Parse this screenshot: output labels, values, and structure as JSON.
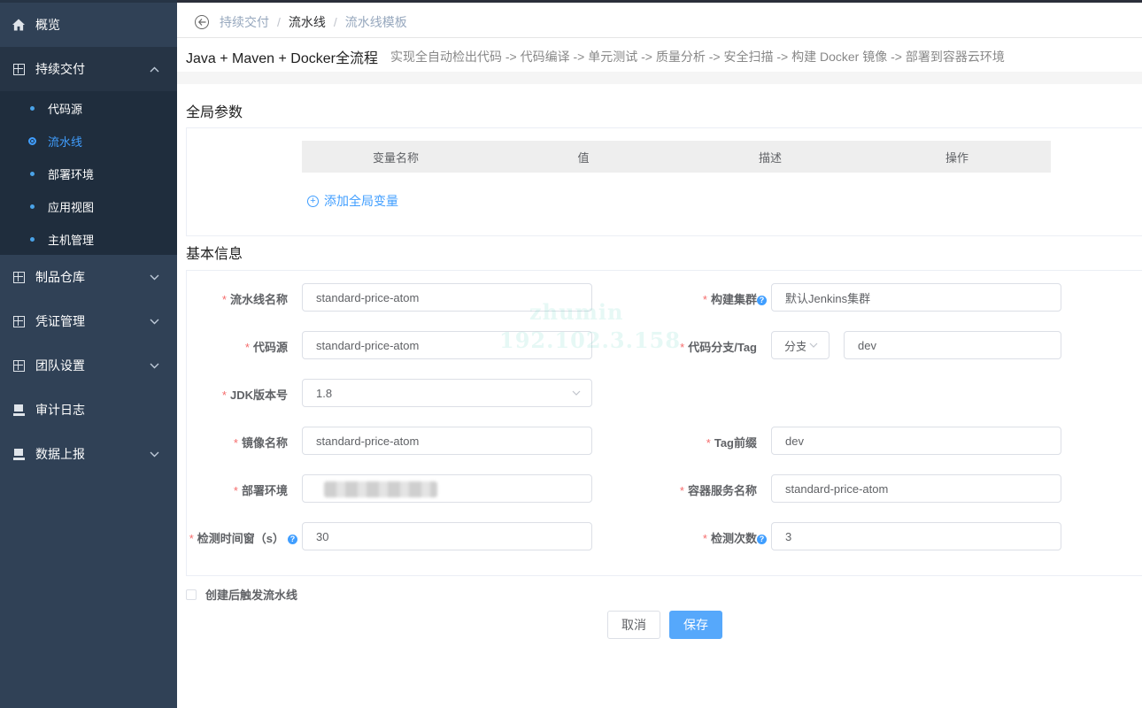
{
  "sidebar": {
    "items": [
      {
        "label": "概览",
        "icon": "home-icon"
      },
      {
        "label": "持续交付",
        "icon": "grid-icon",
        "expanded": true
      },
      {
        "label": "制品仓库",
        "icon": "grid-icon"
      },
      {
        "label": "凭证管理",
        "icon": "grid-icon"
      },
      {
        "label": "团队设置",
        "icon": "grid-icon"
      },
      {
        "label": "审计日志",
        "icon": "monitor-icon"
      },
      {
        "label": "数据上报",
        "icon": "monitor-icon"
      }
    ],
    "sub_items": [
      {
        "label": "代码源"
      },
      {
        "label": "流水线",
        "active": true
      },
      {
        "label": "部署环境"
      },
      {
        "label": "应用视图"
      },
      {
        "label": "主机管理"
      }
    ]
  },
  "breadcrumb": {
    "items": [
      "持续交付",
      "流水线",
      "流水线模板"
    ],
    "separator": "/"
  },
  "pipeline": {
    "title": "Java + Maven + Docker全流程",
    "description": "实现全自动检出代码 -> 代码编译 -> 单元测试 -> 质量分析 -> 安全扫描 -> 构建 Docker 镜像 -> 部署到容器云环境"
  },
  "global_params": {
    "section_title": "全局参数",
    "columns": [
      "变量名称",
      "值",
      "描述",
      "操作"
    ],
    "add_label": "添加全局变量"
  },
  "basic_info": {
    "section_title": "基本信息",
    "fields": {
      "pipeline_name": {
        "label": "流水线名称",
        "value": "standard-price-atom"
      },
      "build_cluster": {
        "label": "构建集群",
        "value": "默认Jenkins集群"
      },
      "code_source": {
        "label": "代码源",
        "value": "standard-price-atom"
      },
      "branch_tag": {
        "label": "代码分支/Tag",
        "type_value": "分支",
        "value": "dev"
      },
      "jdk_version": {
        "label": "JDK版本号",
        "value": "1.8"
      },
      "image_name": {
        "label": "镜像名称",
        "value": "standard-price-atom"
      },
      "tag_prefix": {
        "label": "Tag前缀",
        "value": "dev"
      },
      "deploy_env": {
        "label": "部署环境",
        "value": ""
      },
      "container_service": {
        "label": "容器服务名称",
        "value": "standard-price-atom"
      },
      "check_window": {
        "label": "检测时间窗（s）",
        "value": "30"
      },
      "check_count": {
        "label": "检测次数",
        "value": "3"
      }
    },
    "help_glyph": "?"
  },
  "trigger_checkbox": {
    "label": "创建后触发流水线",
    "checked": false
  },
  "buttons": {
    "cancel": "取消",
    "save": "保存"
  },
  "watermark": {
    "line1": "zhumin",
    "line2": "192.102.3.158"
  },
  "colors": {
    "primary": "#409eff",
    "sidebar_bg": "#304156",
    "required": "#f56c6c"
  }
}
